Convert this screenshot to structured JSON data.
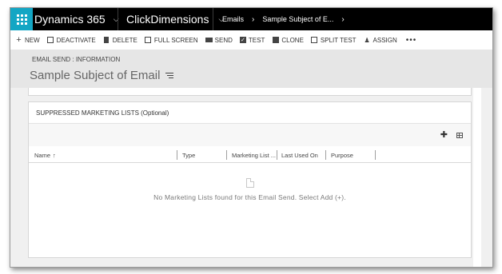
{
  "topnav": {
    "app_name": "Dynamics 365",
    "area_name": "ClickDimensions",
    "breadcrumbs": [
      "Emails",
      "Sample Subject of E..."
    ]
  },
  "commands": [
    {
      "label": "NEW",
      "icon": "plus-icon"
    },
    {
      "label": "DEACTIVATE",
      "icon": "deactivate-icon"
    },
    {
      "label": "DELETE",
      "icon": "trash-icon"
    },
    {
      "label": "FULL SCREEN",
      "icon": "fullscreen-icon"
    },
    {
      "label": "SEND",
      "icon": "envelope-icon"
    },
    {
      "label": "TEST",
      "icon": "checkbox-icon"
    },
    {
      "label": "CLONE",
      "icon": "clone-icon"
    },
    {
      "label": "SPLIT TEST",
      "icon": "split-icon"
    },
    {
      "label": "ASSIGN",
      "icon": "assign-icon"
    }
  ],
  "more_label": "•••",
  "header": {
    "entity_label": "EMAIL SEND : INFORMATION",
    "record_title": "Sample Subject of Email"
  },
  "section": {
    "title": "SUPPRESSED MARKETING LISTS (Optional)",
    "columns": [
      {
        "label": "Name",
        "sort_indicator": "↑"
      },
      {
        "label": "Type"
      },
      {
        "label": "Marketing List ..."
      },
      {
        "label": "Last Used On"
      },
      {
        "label": "Purpose"
      }
    ],
    "empty_message": "No Marketing Lists found for this Email Send. Select Add (+)."
  },
  "colors": {
    "waffle_bg": "#13a6c4",
    "nav_bg": "#000000",
    "header_bg": "#e6e6e6"
  }
}
